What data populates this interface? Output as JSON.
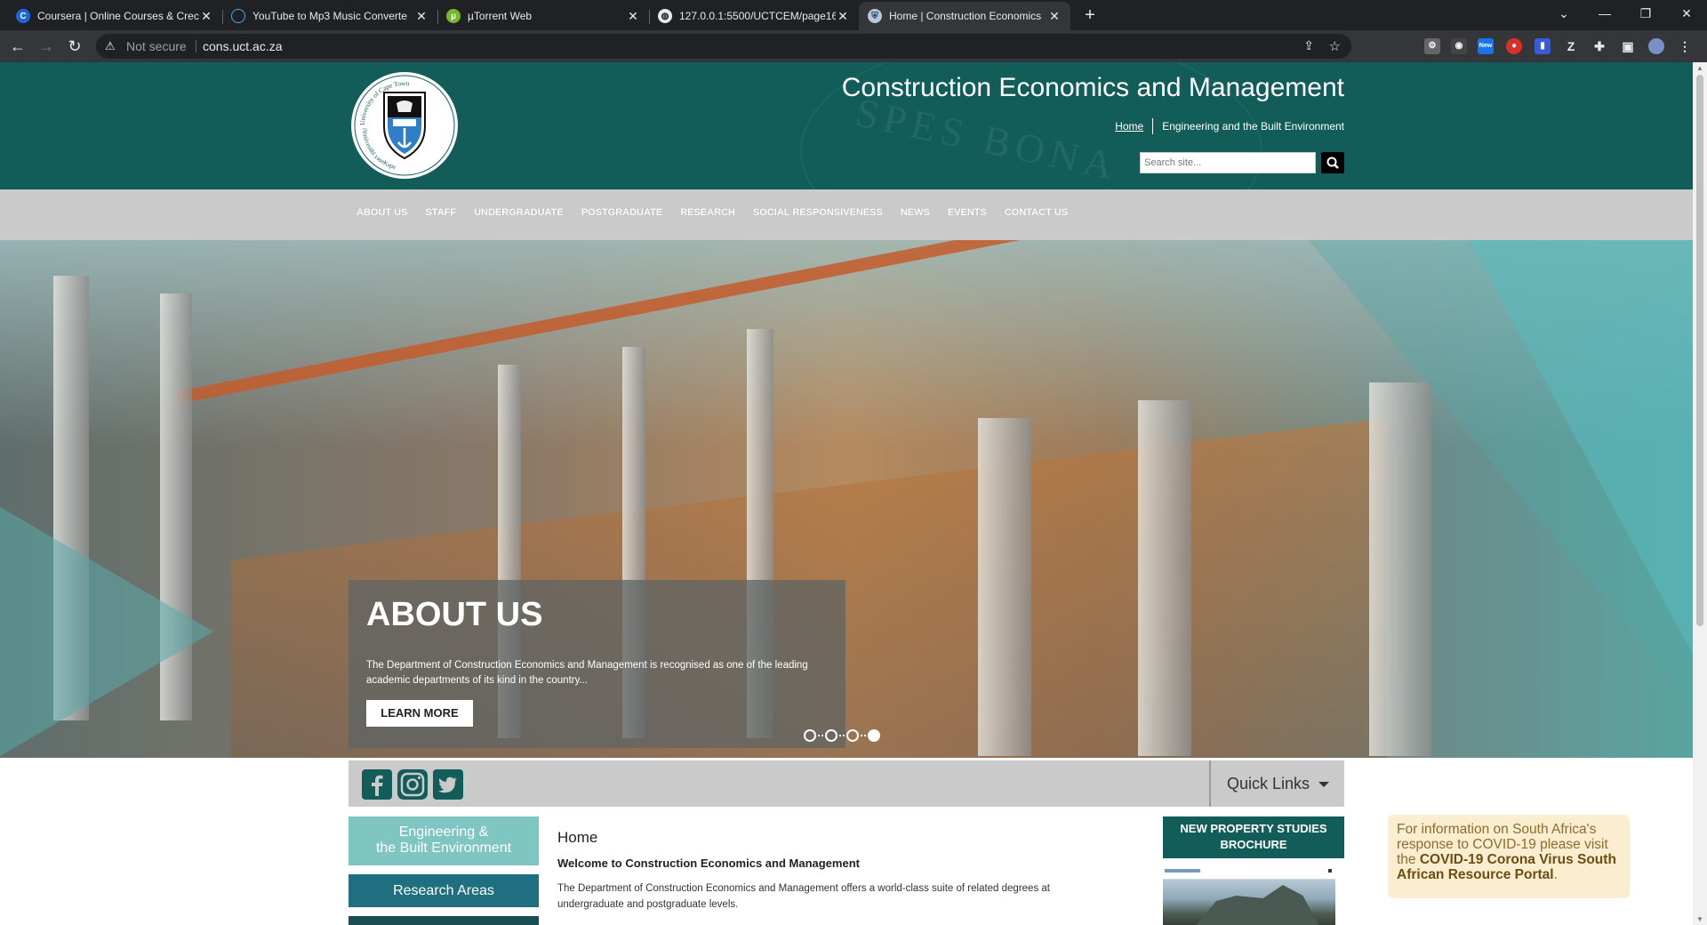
{
  "browser": {
    "tabs": [
      {
        "label": "Coursera | Online Courses & Crec",
        "icon": "coursera-icon",
        "active": false
      },
      {
        "label": "YouTube to Mp3 Music Converte",
        "icon": "cloud-icon",
        "active": false
      },
      {
        "label": "µTorrent Web",
        "icon": "utorrent-icon",
        "active": false
      },
      {
        "label": "127.0.0.1:5500/UCTCEM/page16.",
        "icon": "globe-icon",
        "active": false
      },
      {
        "label": "Home | Construction Economics",
        "icon": "uct-crest-icon",
        "active": true
      }
    ],
    "not_secure": "Not secure",
    "url": "cons.uct.ac.za",
    "ext_badge_new": "New"
  },
  "site": {
    "title": "Construction Economics and Management",
    "breadcrumb_home": "Home",
    "breadcrumb_faculty": "Engineering and the Built Environment",
    "search_placeholder": "Search site...",
    "logo_text_top": "University of Cape Town",
    "logo_text_bottom": "Universiteit van Kaapstad",
    "logo_text_xhosa": "iYunivesithi yaseKapa",
    "watermark": "SPES BONA"
  },
  "nav": [
    "ABOUT US",
    "STAFF",
    "UNDERGRADUATE",
    "POSTGRADUATE",
    "RESEARCH",
    "SOCIAL RESPONSIVENESS",
    "NEWS",
    "EVENTS",
    "CONTACT US"
  ],
  "hero": {
    "title": "ABOUT US",
    "text": "The Department of Construction Economics and Management is recognised as one of the leading academic departments of its kind in the country...",
    "button": "LEARN MORE",
    "slides": 4,
    "active_slide": 4
  },
  "social": {
    "quick_links": "Quick Links",
    "icons": [
      "facebook-icon",
      "instagram-icon",
      "twitter-icon"
    ]
  },
  "sidebar": {
    "ebe_line1": "Engineering &",
    "ebe_line2": "the Built Environment",
    "research": "Research Areas"
  },
  "main": {
    "heading": "Home",
    "welcome": "Welcome to Construction Economics and Management",
    "body": "The Department of Construction Economics and Management offers a world-class suite of related degrees at undergraduate and postgraduate levels."
  },
  "brochure": {
    "line1": "NEW PROPERTY STUDIES",
    "line2": "BROCHURE"
  },
  "covid": {
    "text": "For information on South Africa's response to COVID-19 please visit the ",
    "link": "COVID-19 Corona Virus South African Resource Portal",
    "end": "."
  },
  "colors": {
    "brand_teal": "#125d5a",
    "nav_grey": "#cacaca",
    "sidebar_light": "#7fc5c1",
    "sidebar_mid": "#1f6f80"
  }
}
